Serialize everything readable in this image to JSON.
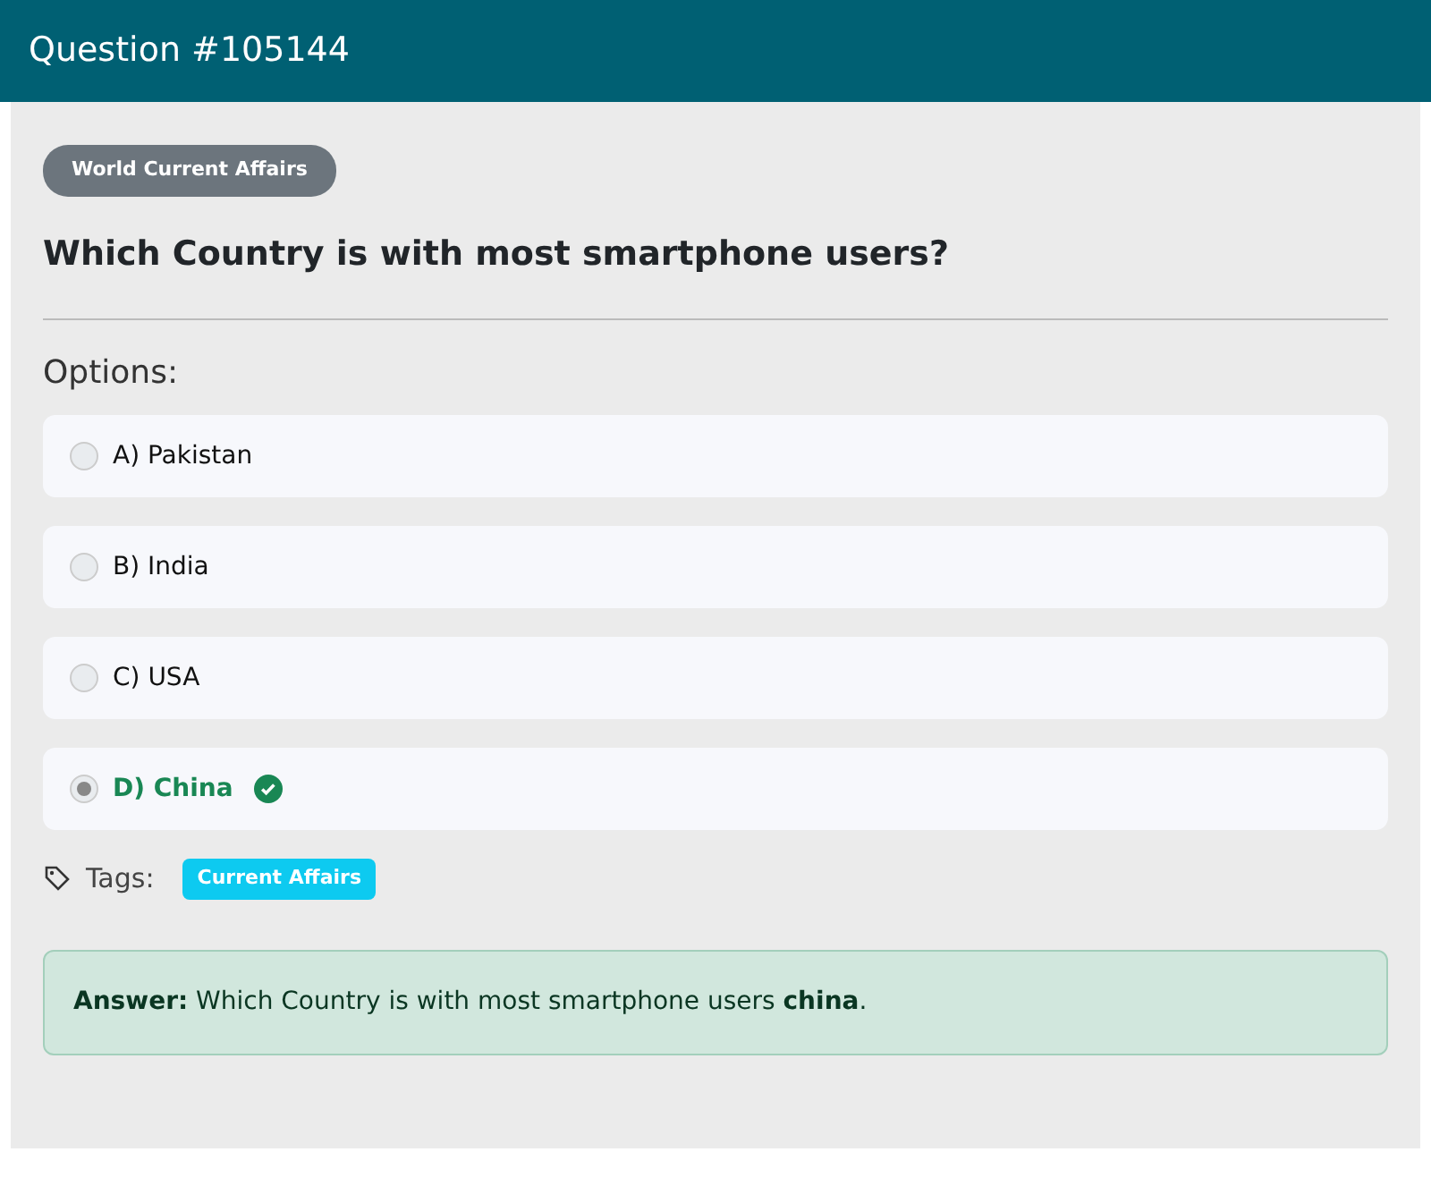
{
  "header": {
    "title": "Question #105144"
  },
  "category": "World Current Affairs",
  "question": "Which Country is with most smartphone users?",
  "options_label": "Options:",
  "options": [
    {
      "label": "A) Pakistan",
      "selected": false,
      "correct": false
    },
    {
      "label": "B) India",
      "selected": false,
      "correct": false
    },
    {
      "label": "C) USA",
      "selected": false,
      "correct": false
    },
    {
      "label": "D) China",
      "selected": true,
      "correct": true
    }
  ],
  "tags_label": "Tags:",
  "tags": [
    "Current Affairs"
  ],
  "answer": "**Answer:** Which Country is with most smartphone users **china**."
}
